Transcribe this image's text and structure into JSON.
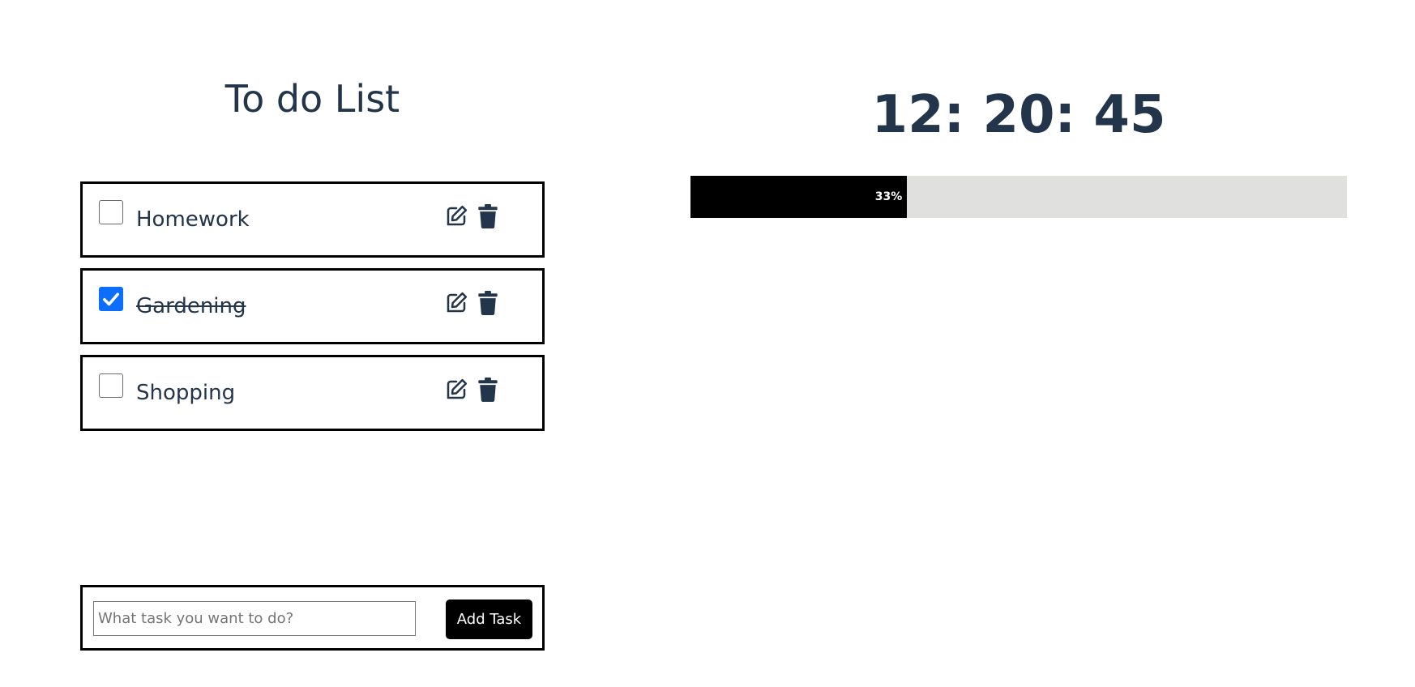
{
  "todo": {
    "title": "To do List",
    "tasks": [
      {
        "label": "Homework",
        "checked": false
      },
      {
        "label": "Gardening",
        "checked": true
      },
      {
        "label": "Shopping",
        "checked": false
      }
    ],
    "input_placeholder": "What task you want to do?",
    "input_value": "",
    "add_button_label": "Add Task"
  },
  "clock": {
    "time": "12: 20: 45"
  },
  "progress": {
    "value": 0.33,
    "label": "33%"
  },
  "colors": {
    "text": "#22354a",
    "checkbox_checked": "#0d6efd",
    "progress_fill": "#000000",
    "progress_track": "#e0e0de"
  },
  "icons": {
    "edit": "edit-icon",
    "delete": "trash-icon",
    "check": "check-icon"
  }
}
